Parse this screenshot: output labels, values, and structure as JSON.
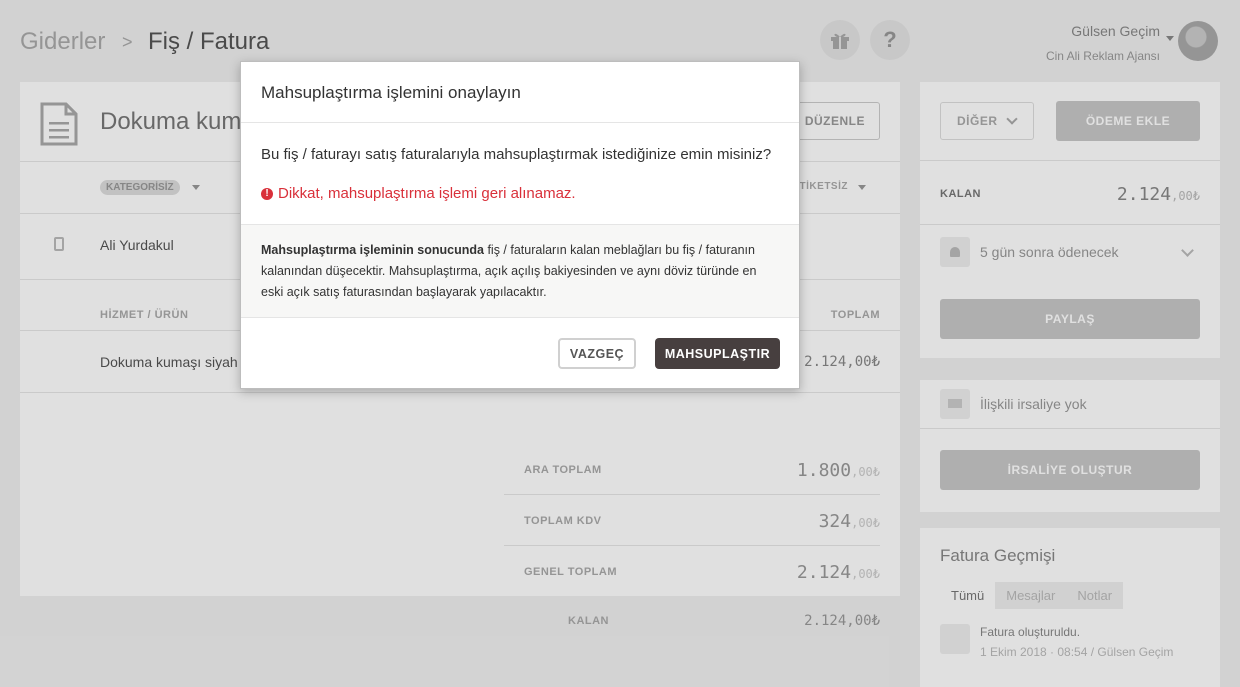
{
  "breadcrumb": {
    "parent": "Giderler",
    "separator": ">",
    "current": "Fiş / Fatura"
  },
  "header_icons": {
    "gift": "gift-icon",
    "help": "?"
  },
  "user": {
    "name": "Gülsen Geçim",
    "company": "Cin Ali Reklam Ajansı"
  },
  "document": {
    "title": "Dokuma kum",
    "edit_label": "DÜZENLE",
    "category_label": "KATEGORİSİZ",
    "tag_label": "ETİKETSİZ",
    "contact_name": "Ali Yurdakul",
    "columns": {
      "item": "HİZMET / ÜRÜN",
      "total": "TOPLAM"
    },
    "line_items": [
      {
        "description": "Dokuma kumaşı siyah",
        "total": "2.124,00₺"
      }
    ],
    "totals": [
      {
        "label": "ARA TOPLAM",
        "main": "1.800",
        "dec": ",00₺"
      },
      {
        "label": "TOPLAM KDV",
        "main": "324",
        "dec": ",00₺"
      },
      {
        "label": "GENEL TOPLAM",
        "main": "2.124",
        "dec": ",00₺"
      }
    ],
    "remaining": {
      "label": "KALAN",
      "value": "2.124,00₺"
    }
  },
  "sidebar": {
    "other_label": "DİĞER",
    "add_payment_label": "ÖDEME EKLE",
    "remaining_label": "KALAN",
    "remaining_main": "2.124",
    "remaining_dec": ",00₺",
    "reminder_text": "5 gün sonra ödenecek",
    "share_label": "PAYLAŞ",
    "waybill_text": "İlişkili irsaliye yok",
    "create_waybill_label": "İRSALİYE OLUŞTUR",
    "history": {
      "title": "Fatura Geçmişi",
      "tabs": [
        "Tümü",
        "Mesajlar",
        "Notlar"
      ],
      "event": "Fatura oluşturuldu.",
      "meta": "1 Ekim 2018 · 08:54 / Gülsen Geçim"
    }
  },
  "modal": {
    "title": "Mahsuplaştırma işlemini onaylayın",
    "question": "Bu fiş / faturayı satış faturalarıyla mahsuplaştırmak istediğinize emin misiniz?",
    "warning": "Dikkat, mahsuplaştırma işlemi geri alınamaz.",
    "info_bold": "Mahsuplaştırma işleminin sonucunda",
    "info_rest": " fiş / faturaların kalan meblağları bu fiş / faturanın kalanından düşecektir. Mahsuplaştırma, açık açılış bakiyesinden ve aynı döviz türünde en eski açık satış faturasından başlayarak yapılacaktır.",
    "cancel_label": "VAZGEÇ",
    "confirm_label": "MAHSUPLAŞTIR"
  },
  "colors": {
    "warning": "#d9303a",
    "confirm_button": "#473f3f"
  }
}
